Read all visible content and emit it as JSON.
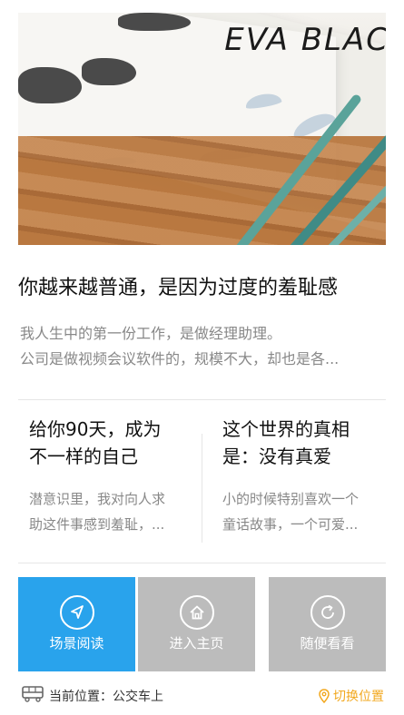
{
  "hero": {
    "brand_text": "EVA BLAC"
  },
  "feature": {
    "title": "你越来越普通，是因为过度的羞耻感",
    "lines": [
      "我人生中的第一份工作，是做经理助理。",
      "公司是做视频会议软件的，规模不大，却也是各..."
    ]
  },
  "cards": [
    {
      "title_lines": [
        "给你90天，成为",
        "不一样的自己"
      ],
      "body_lines": [
        "潜意识里，我对向人求",
        "助这件事感到羞耻，..."
      ]
    },
    {
      "title_lines": [
        "这个世界的真相",
        "是：没有真爱"
      ],
      "body_lines": [
        "小的时候特别喜欢一个",
        "童话故事，一个可爱..."
      ]
    }
  ],
  "actions": [
    {
      "label": "场景阅读",
      "icon": "navigation-arrow-icon",
      "active": true
    },
    {
      "label": "进入主页",
      "icon": "home-icon",
      "active": false
    },
    {
      "label": "随便看看",
      "icon": "refresh-icon",
      "active": false
    }
  ],
  "footer": {
    "location_text": "当前位置：公交车上",
    "switch_label": "切换位置"
  },
  "colors": {
    "accent_blue": "#29a3ec",
    "button_gray": "#bcbcbc",
    "switch_orange": "#f2a81f"
  }
}
